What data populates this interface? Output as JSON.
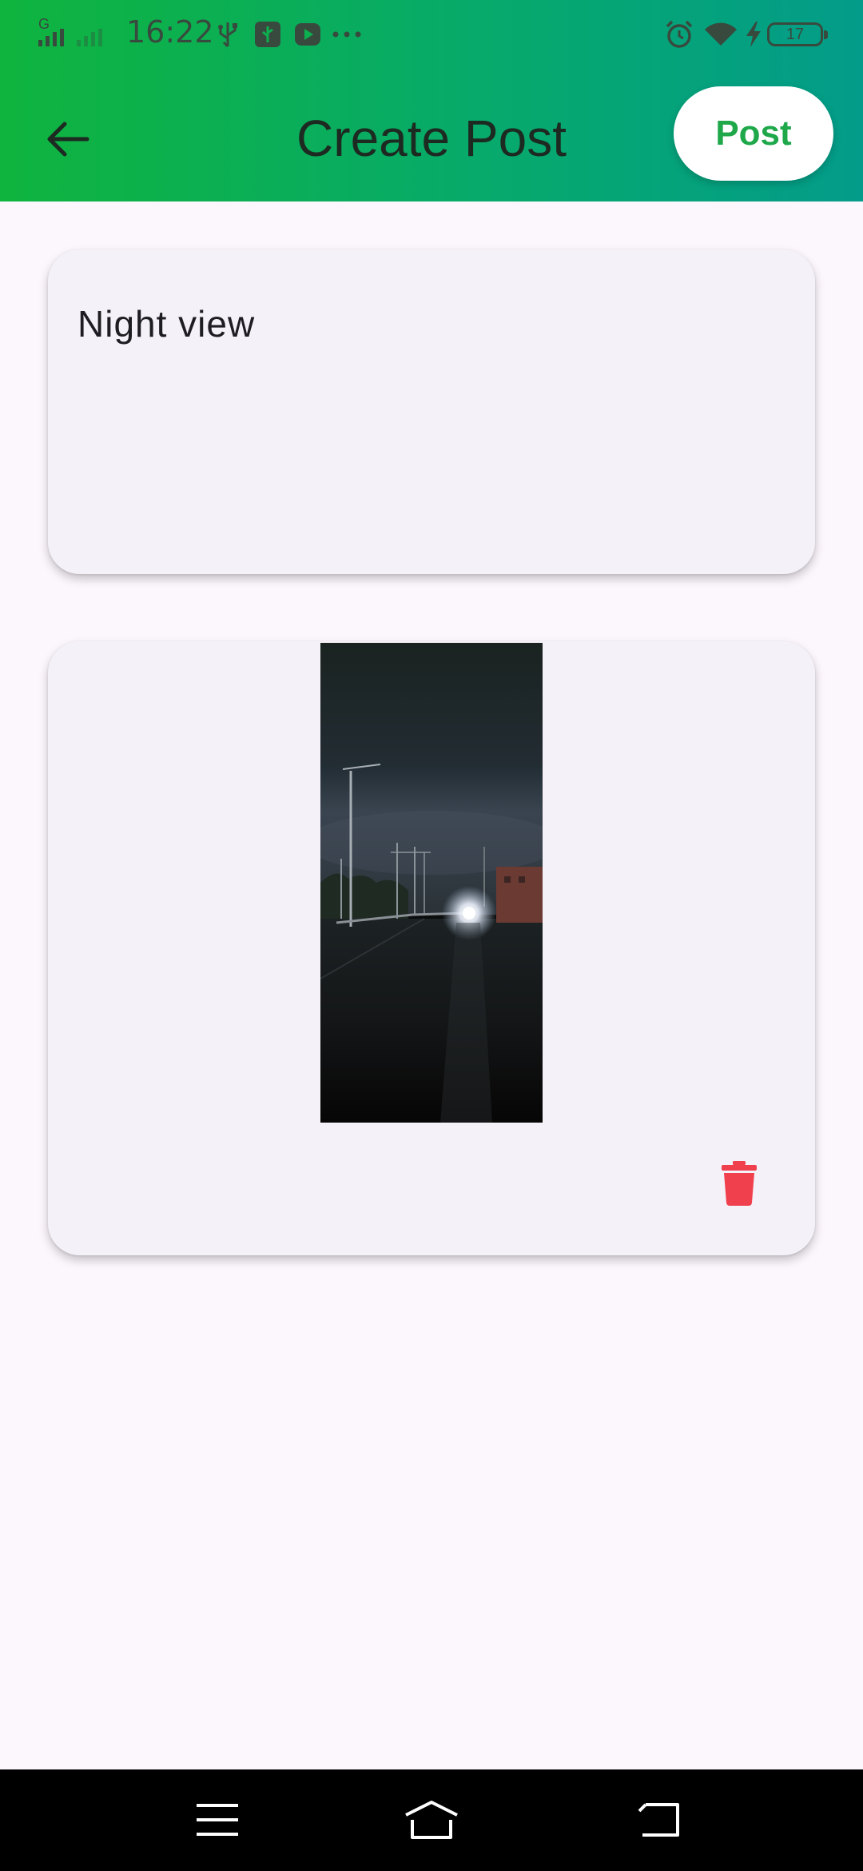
{
  "status_bar": {
    "network_label": "G",
    "time": "16:22",
    "battery_level": "17"
  },
  "app_bar": {
    "back_icon": "arrow-left-icon",
    "title": "Create Post",
    "post_label": "Post"
  },
  "composer": {
    "text_value": "Night view"
  },
  "media": {
    "image_icon": "night-road-photo",
    "delete_icon": "trash-icon"
  },
  "nav_bar": {
    "menu_icon": "menu-icon",
    "home_icon": "home-icon",
    "back_icon": "back-icon"
  },
  "colors": {
    "header_gradient_start": "#0fb43e",
    "header_gradient_end": "#039c8a",
    "post_button_text": "#1ea84a",
    "delete_icon": "#f0404e",
    "page_background": "#fcf7fd",
    "card_background": "#f5f1f8"
  }
}
